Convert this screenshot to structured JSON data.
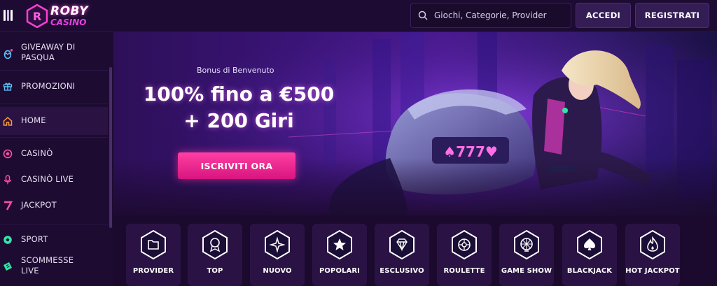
{
  "header": {
    "logo_line1": "ROBY",
    "logo_line2": "CASINO",
    "search_placeholder": "Giochi, Categorie, Provider",
    "login_label": "ACCEDI",
    "register_label": "REGISTRATI"
  },
  "sidebar": {
    "items": [
      {
        "label_line1": "GIVEAWAY DI",
        "label_line2": "PASQUA",
        "icon": "easter-egg-icon"
      },
      {
        "label": "PROMOZIONI",
        "icon": "gift-icon"
      },
      {
        "label": "HOME",
        "icon": "home-icon"
      },
      {
        "label": "CASINÒ",
        "icon": "casino-chip-icon"
      },
      {
        "label": "CASINÒ LIVE",
        "icon": "live-microphone-icon"
      },
      {
        "label": "JACKPOT",
        "icon": "seven-icon"
      },
      {
        "label": "SPORT",
        "icon": "soccer-ball-icon"
      },
      {
        "label_line1": "SCOMMESSE",
        "label_line2": "LIVE",
        "icon": "live-ticket-icon"
      }
    ]
  },
  "banner": {
    "subtitle": "Bonus di Benvenuto",
    "title_line1": "100% fino a €500",
    "title_line2": "+ 200 Giri",
    "cta": "ISCRIVITI ORA"
  },
  "categories": [
    {
      "label": "PROVIDER",
      "icon": "folder-icon"
    },
    {
      "label": "TOP",
      "icon": "award-badge-icon"
    },
    {
      "label": "NUOVO",
      "icon": "sparkles-icon"
    },
    {
      "label": "POPOLARI",
      "icon": "star-icon"
    },
    {
      "label": "ESCLUSIVO",
      "icon": "diamond-icon"
    },
    {
      "label": "ROULETTE",
      "icon": "roulette-icon"
    },
    {
      "label": "GAME SHOW",
      "icon": "wheel-icon"
    },
    {
      "label": "BLACKJACK",
      "icon": "spade-icon"
    },
    {
      "label": "HOT JACKPOT",
      "icon": "flame-icon"
    }
  ],
  "colors": {
    "accent_pink": "#ff3fa3",
    "logo_pink": "#e83fe0",
    "bg": "#1c0a2e",
    "panel": "#2a1344"
  }
}
